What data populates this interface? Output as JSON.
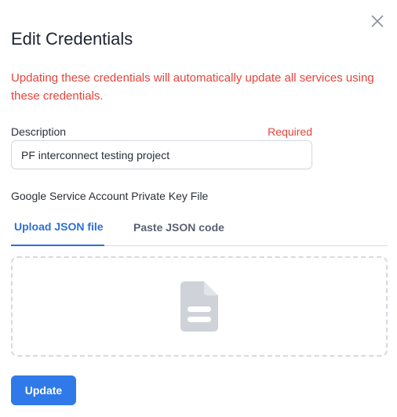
{
  "dialog": {
    "title": "Edit Credentials",
    "close_icon": "close-icon",
    "warning": "Updating these credentials will automatically update all services using these credentials.",
    "colors": {
      "warning": "#e5443b",
      "accent": "#2f7ae8",
      "tab_active": "#2d6fd6"
    }
  },
  "description": {
    "label": "Description",
    "required_label": "Required",
    "value": "PF interconnect testing project",
    "placeholder": ""
  },
  "key_file": {
    "label": "Google Service Account Private Key File",
    "tabs": [
      {
        "label": "Upload JSON file",
        "active": true
      },
      {
        "label": "Paste JSON code",
        "active": false
      }
    ],
    "dropzone_icon": "file-icon"
  },
  "actions": {
    "update_label": "Update"
  }
}
